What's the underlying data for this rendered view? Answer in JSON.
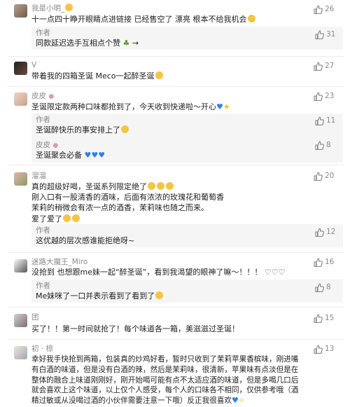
{
  "thumb_icon": "thumbs-up-icon",
  "colors": {
    "muted": "#8a8a8a",
    "reply_bg": "#f5f5f5",
    "heart": "#2f7fe6"
  },
  "comments": [
    {
      "user": "我是小明_",
      "likes": "26",
      "text": "十一点四十睁开眼睛点进链接 已经售空了 漂亮 根本不给我机会",
      "replies": [
        {
          "name": "作者",
          "text": "同款延迟选手互相点个赞",
          "likes": "31"
        }
      ]
    },
    {
      "user": "V",
      "likes": "27",
      "text": "带着我的四箱圣诞 Meco一起醉圣诞"
    },
    {
      "user": "皮皮",
      "likes": "23",
      "text": "圣诞限定款两种口味都抢到了，今天收到快递啦～开心",
      "replies": [
        {
          "name": "作者",
          "text": "圣诞醉快乐的事安排上了",
          "likes": "11"
        },
        {
          "name": "皮皮",
          "text": "圣诞聚会必备",
          "likes": "8"
        }
      ]
    },
    {
      "user": "溜溜",
      "likes": "20",
      "text_lines": [
        "真的超级好喝，圣诞系列限定绝了",
        "刚入口有一股清香的酒味，后面有浓浓的玫瑰花和葡萄香",
        "茉莉的稍微会有浓一点的酒香，茉莉味也随之而来。",
        "爱了爱了"
      ],
      "replies": [
        {
          "name": "作者",
          "text": "这优越的层次感谁能拒绝呀~",
          "likes": "12"
        }
      ]
    },
    {
      "user": "迷路大魔王_Miro",
      "likes": "16",
      "text": "没抢到 也想跟me妹一起“醉圣诞”，看到我渴望的眼神了嘛～！！！ ♡♡♡",
      "replies": [
        {
          "name": "作者",
          "text": "Me妹咪了一口并表示看到了看到了",
          "likes": "8"
        }
      ]
    },
    {
      "user": "团",
      "likes": "15",
      "text": "买了！！第一时间就抢了！每个味道各一箱，美滋滋过圣诞！"
    },
    {
      "user": "初 · 椋",
      "likes": "13",
      "text_lines": [
        "幸好我手快抢到两箱，包装真的炒鸡好看，暂时只收到了茉莉苹果香槟味，刚进嘴",
        "有白酒的味道，但是没有白酒的辣，然后是茉莉味，很清新，苹果味有点淡但是在",
        "整体的融合上味道刚刚好，刚开始喝可能有点不太适应酒的味道，但是多喝几口后",
        "就会喜欢上这个味道，以上仅个人感受，每个人的口味各不相同，仅供参考哦（酒",
        "精过敏或从没喝过酒的小伙伴需要注意一下哦）反正我很喜欢"
      ]
    }
  ]
}
